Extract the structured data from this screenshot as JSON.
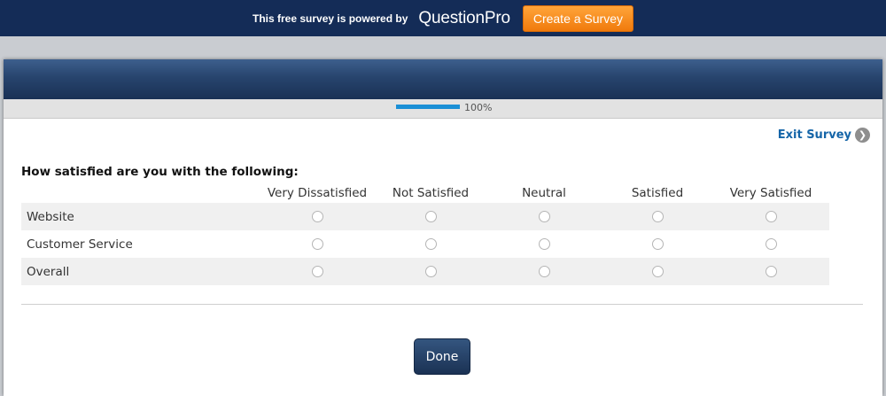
{
  "promo": {
    "text": "This free survey is powered by",
    "brand": "QuestionPro",
    "cta_label": "Create a Survey"
  },
  "progress": {
    "label": "100%",
    "fraction": 1.0
  },
  "exit": {
    "label": "Exit Survey",
    "icon": "arrow-right-circle-icon"
  },
  "question": {
    "text": "How satisfied are you with the following:",
    "columns": [
      "Very Dissatisfied",
      "Not Satisfied",
      "Neutral",
      "Satisfied",
      "Very Satisfied"
    ],
    "rows": [
      "Website",
      "Customer Service",
      "Overall"
    ]
  },
  "done_label": "Done",
  "colors": {
    "promo_bg": "#142c57",
    "cta_orange": "#f7901e",
    "progress_fill": "#1a8fd6",
    "link_blue": "#1565a8",
    "done_bg": "#1f3a60"
  }
}
